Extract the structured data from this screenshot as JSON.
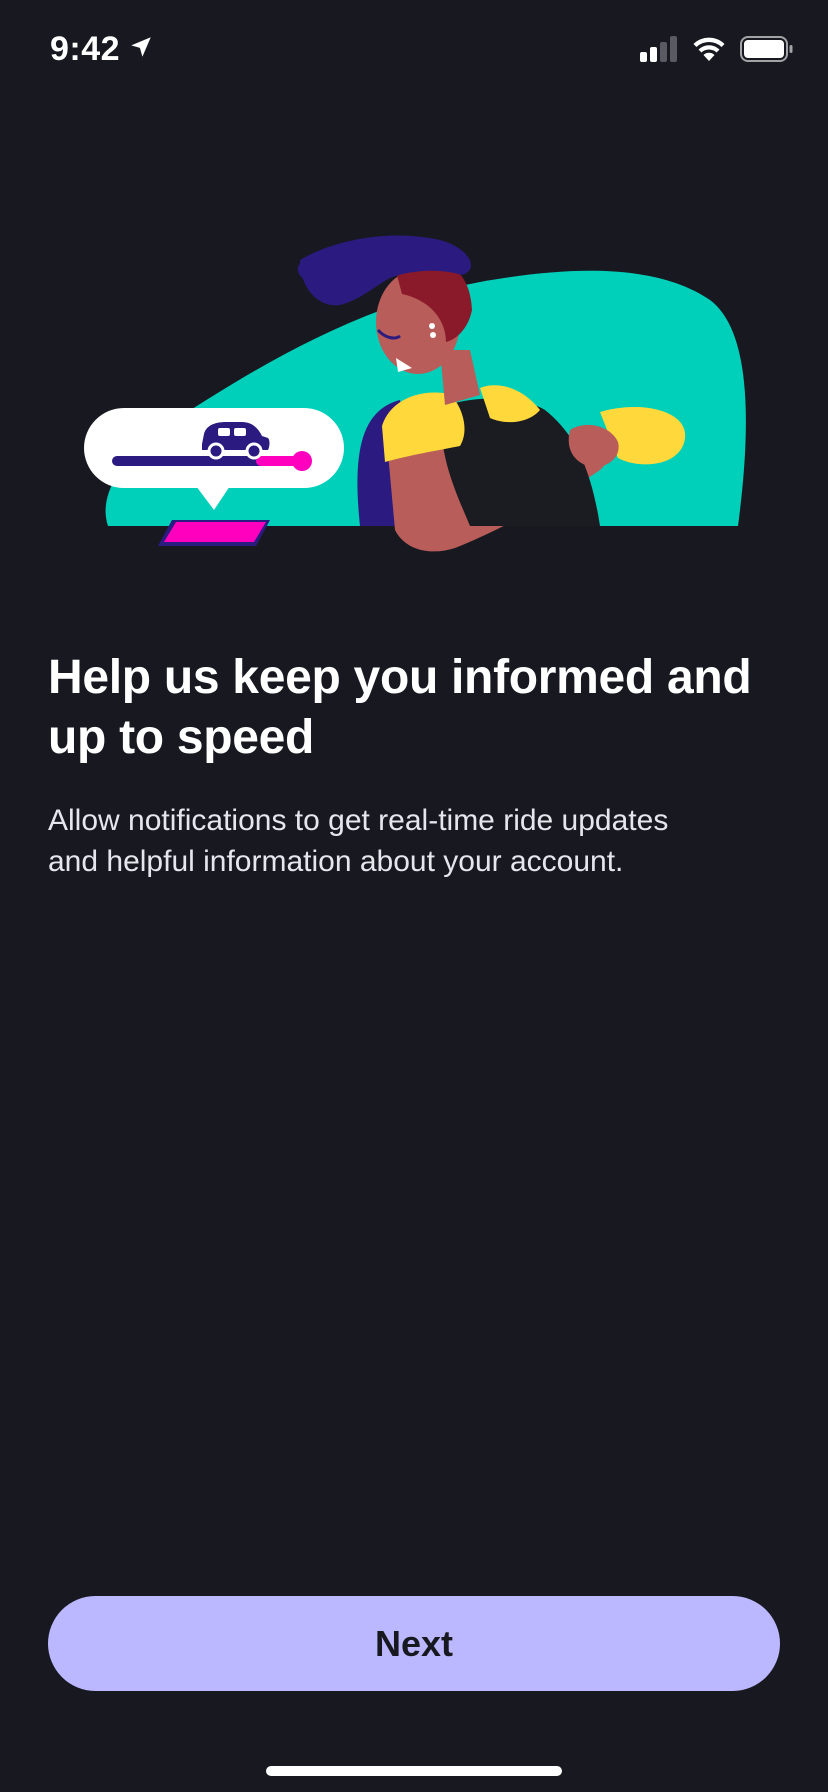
{
  "status_bar": {
    "time": "9:42",
    "location_icon": "location-arrow-icon",
    "signal_icon": "cellular-signal-icon",
    "wifi_icon": "wifi-icon",
    "battery_icon": "battery-icon"
  },
  "illustration": {
    "icon": "notification-illustration",
    "car_icon": "car-icon"
  },
  "content": {
    "headline_line1": "Help us keep you informed and",
    "headline_line2": "up to speed",
    "body_line1": "Allow notifications to get real-time ride updates",
    "body_line2": "and helpful information about your account."
  },
  "actions": {
    "next_label": "Next"
  },
  "colors": {
    "background": "#181920",
    "button": "#bcb8ff",
    "teal": "#00cfb9",
    "magenta": "#ff00bf",
    "indigo": "#2b1a80",
    "yellow": "#ffd93b"
  }
}
